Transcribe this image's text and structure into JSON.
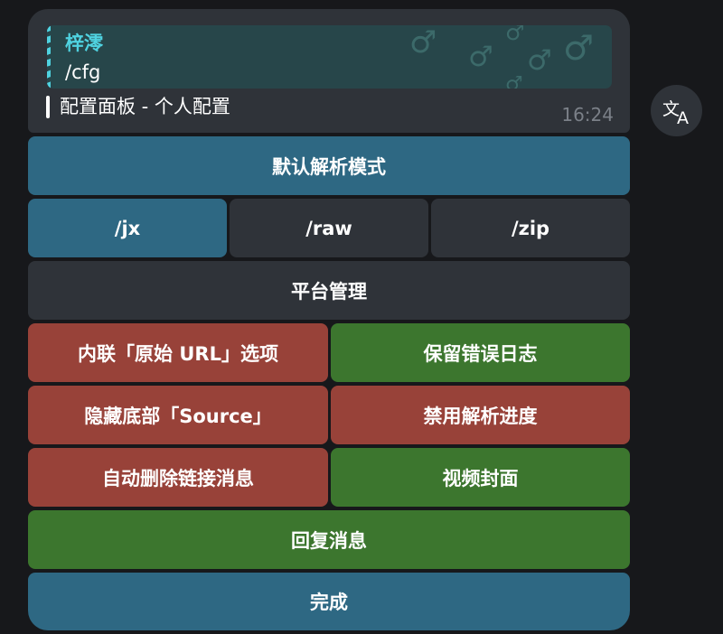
{
  "message": {
    "reply": {
      "author": "梓澪",
      "text": "/cfg"
    },
    "text": "配置面板 - 个人配置",
    "time": "16:24"
  },
  "translate_button": {
    "icon": "translate-icon",
    "glyph_a": "文",
    "glyph_b": "A"
  },
  "background_pattern": {
    "glyph": "♂"
  },
  "keyboard": {
    "default_mode": "默认解析模式",
    "jx": "/jx",
    "raw": "/raw",
    "zip": "/zip",
    "platform": "平台管理",
    "inline_url": "内联「原始 URL」选项",
    "keep_error_log": "保留错误日志",
    "hide_source": "隐藏底部「Source」",
    "disable_progress": "禁用解析进度",
    "auto_delete": "自动删除链接消息",
    "video_cover": "视频封面",
    "reply_message": "回复消息",
    "done": "完成"
  },
  "colors": {
    "blue": "#2e6883",
    "gray": "#2f3339",
    "red": "#984239",
    "green": "#3c762e",
    "accent_cyan": "#4fd2e0"
  }
}
